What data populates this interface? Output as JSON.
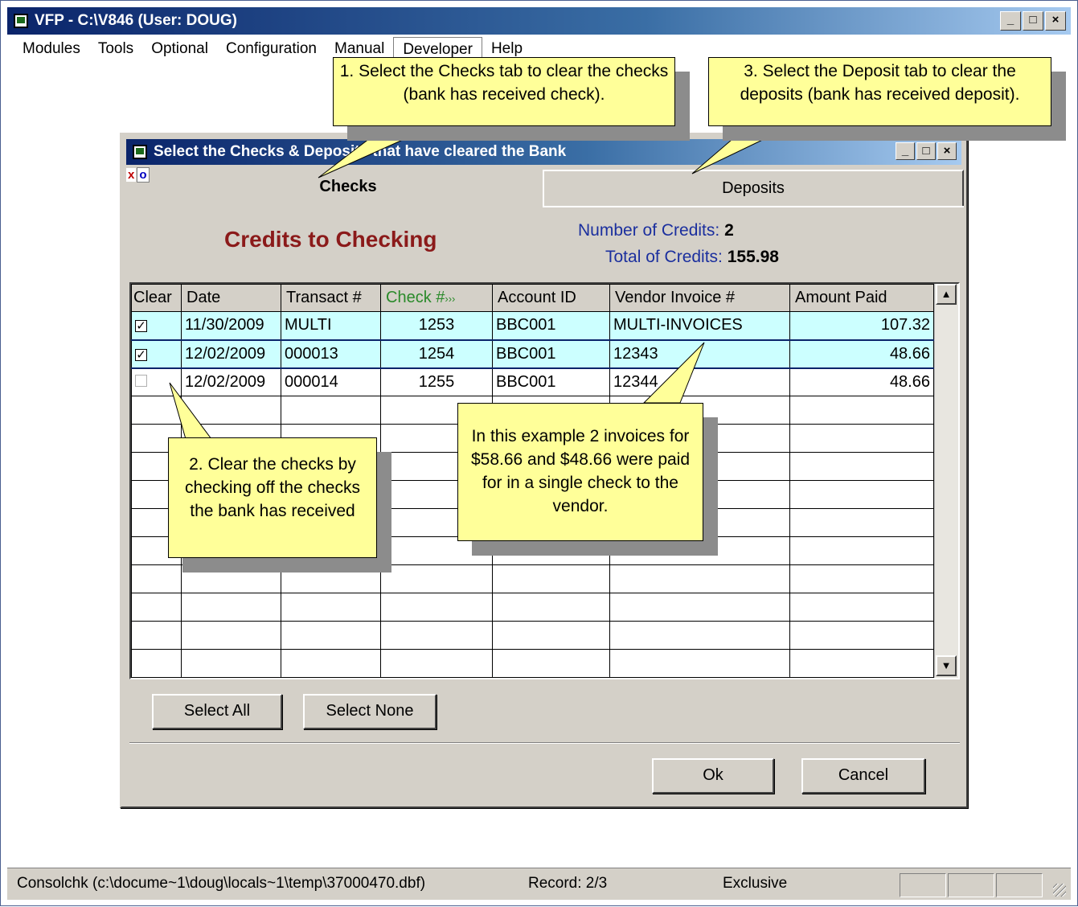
{
  "main_window": {
    "title": "VFP - C:\\V846  (User: DOUG)",
    "menu": [
      "Modules",
      "Tools",
      "Optional",
      "Configuration",
      "Manual",
      "Developer",
      "Help"
    ],
    "window_buttons": {
      "minimize": "_",
      "maximize": "□",
      "close": "×"
    }
  },
  "dialog": {
    "title": "Select the Checks & Deposits that have cleared the Bank",
    "toolbar_x": "x",
    "toolbar_o": "o",
    "tabs": [
      {
        "label": "Checks",
        "active": true
      },
      {
        "label": "Deposits",
        "active": false
      }
    ],
    "heading": "Credits to Checking",
    "number_of_credits_label": "Number of Credits:",
    "number_of_credits_value": "2",
    "total_of_credits_label": "Total of Credits:",
    "total_of_credits_value": "155.98",
    "grid": {
      "columns": [
        "Clear",
        "Date",
        "Transact #",
        "Check #",
        "Account ID",
        "Vendor Invoice #",
        "Amount Paid"
      ],
      "check_sort_marker": "›››",
      "rows": [
        {
          "clear": true,
          "date": "11/30/2009",
          "transact": "MULTI",
          "check": "1253",
          "account": "BBC001",
          "invoice": "MULTI-INVOICES",
          "amount": "107.32"
        },
        {
          "clear": true,
          "date": "12/02/2009",
          "transact": "000013",
          "check": "1254",
          "account": "BBC001",
          "invoice": "12343",
          "amount": "48.66"
        },
        {
          "clear": false,
          "date": "12/02/2009",
          "transact": "000014",
          "check": "1255",
          "account": "BBC001",
          "invoice": "12344",
          "amount": "48.66"
        }
      ],
      "selected_row": 2
    },
    "buttons": {
      "select_all": "Select All",
      "select_none": "Select None",
      "ok": "Ok",
      "cancel": "Cancel"
    }
  },
  "callouts": {
    "one": "1. Select the Checks tab to clear the checks (bank has received check).",
    "two": "2. Clear the checks by checking off the checks the bank has received",
    "three": "3. Select the Deposit tab to clear the deposits (bank has received deposit).",
    "example": "In this example 2 invoices for $58.66 and $48.66 were paid for in a single check to the vendor."
  },
  "status_bar": {
    "file": "Consolchk (c:\\docume~1\\doug\\locals~1\\temp\\37000470.dbf)",
    "record": "Record: 2/3",
    "mode": "Exclusive"
  },
  "colors": {
    "heading": "#8b1a1a",
    "credit_labels": "#1b2f9e",
    "check_header": "#2a8a2a",
    "highlight_row": "#ccffff",
    "callout_fill": "#ffff99"
  }
}
